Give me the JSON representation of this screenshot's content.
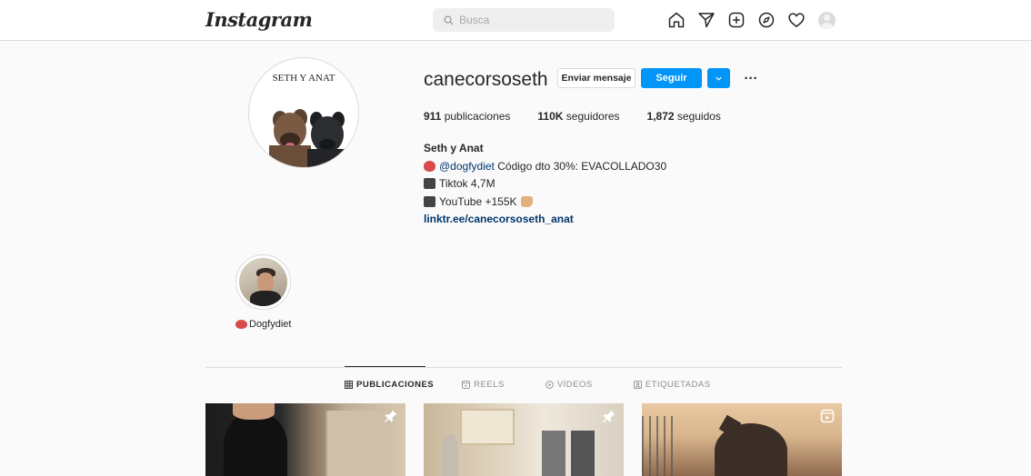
{
  "nav": {
    "logo": "Instagram",
    "search_placeholder": "Busca",
    "icons": [
      "home-icon",
      "direct-icon",
      "new-post-icon",
      "explore-icon",
      "activity-icon",
      "profile-avatar"
    ]
  },
  "profile": {
    "picture_caption": "SETH Y ANAT",
    "username": "canecorsoseth",
    "message_button": "Enviar mensaje",
    "follow_button": "Seguir",
    "more_button": "···",
    "stats": {
      "posts_count": "911",
      "posts_label": "publicaciones",
      "followers_count": "110K",
      "followers_label": "seguidores",
      "following_count": "1,872",
      "following_label": "seguidos"
    },
    "bio": {
      "name": "Seth y Anat",
      "line1_mention": "@dogfydiet",
      "line1_text": "Código dto 30%: EVACOLLADO30",
      "line2_text": "Tiktok 4,7M",
      "line3_text": "YouTube +155K",
      "link": "linktr.ee/canecorsoseth_anat"
    }
  },
  "highlights": [
    {
      "label": "Dogfydiet"
    }
  ],
  "tabs": [
    {
      "label": "PUBLICACIONES",
      "active": true,
      "icon": "grid-icon"
    },
    {
      "label": "REELS",
      "active": false,
      "icon": "reels-icon"
    },
    {
      "label": "VÍDEOS",
      "active": false,
      "icon": "video-icon"
    },
    {
      "label": "ETIQUETADAS",
      "active": false,
      "icon": "tagged-icon"
    }
  ],
  "posts": [
    {
      "badge": "pin-icon"
    },
    {
      "badge": "pin-icon"
    },
    {
      "badge": "reel-icon"
    }
  ],
  "colors": {
    "accent": "#0095f6",
    "link": "#00376b",
    "background": "#fafafa",
    "border": "#dbdbdb"
  }
}
